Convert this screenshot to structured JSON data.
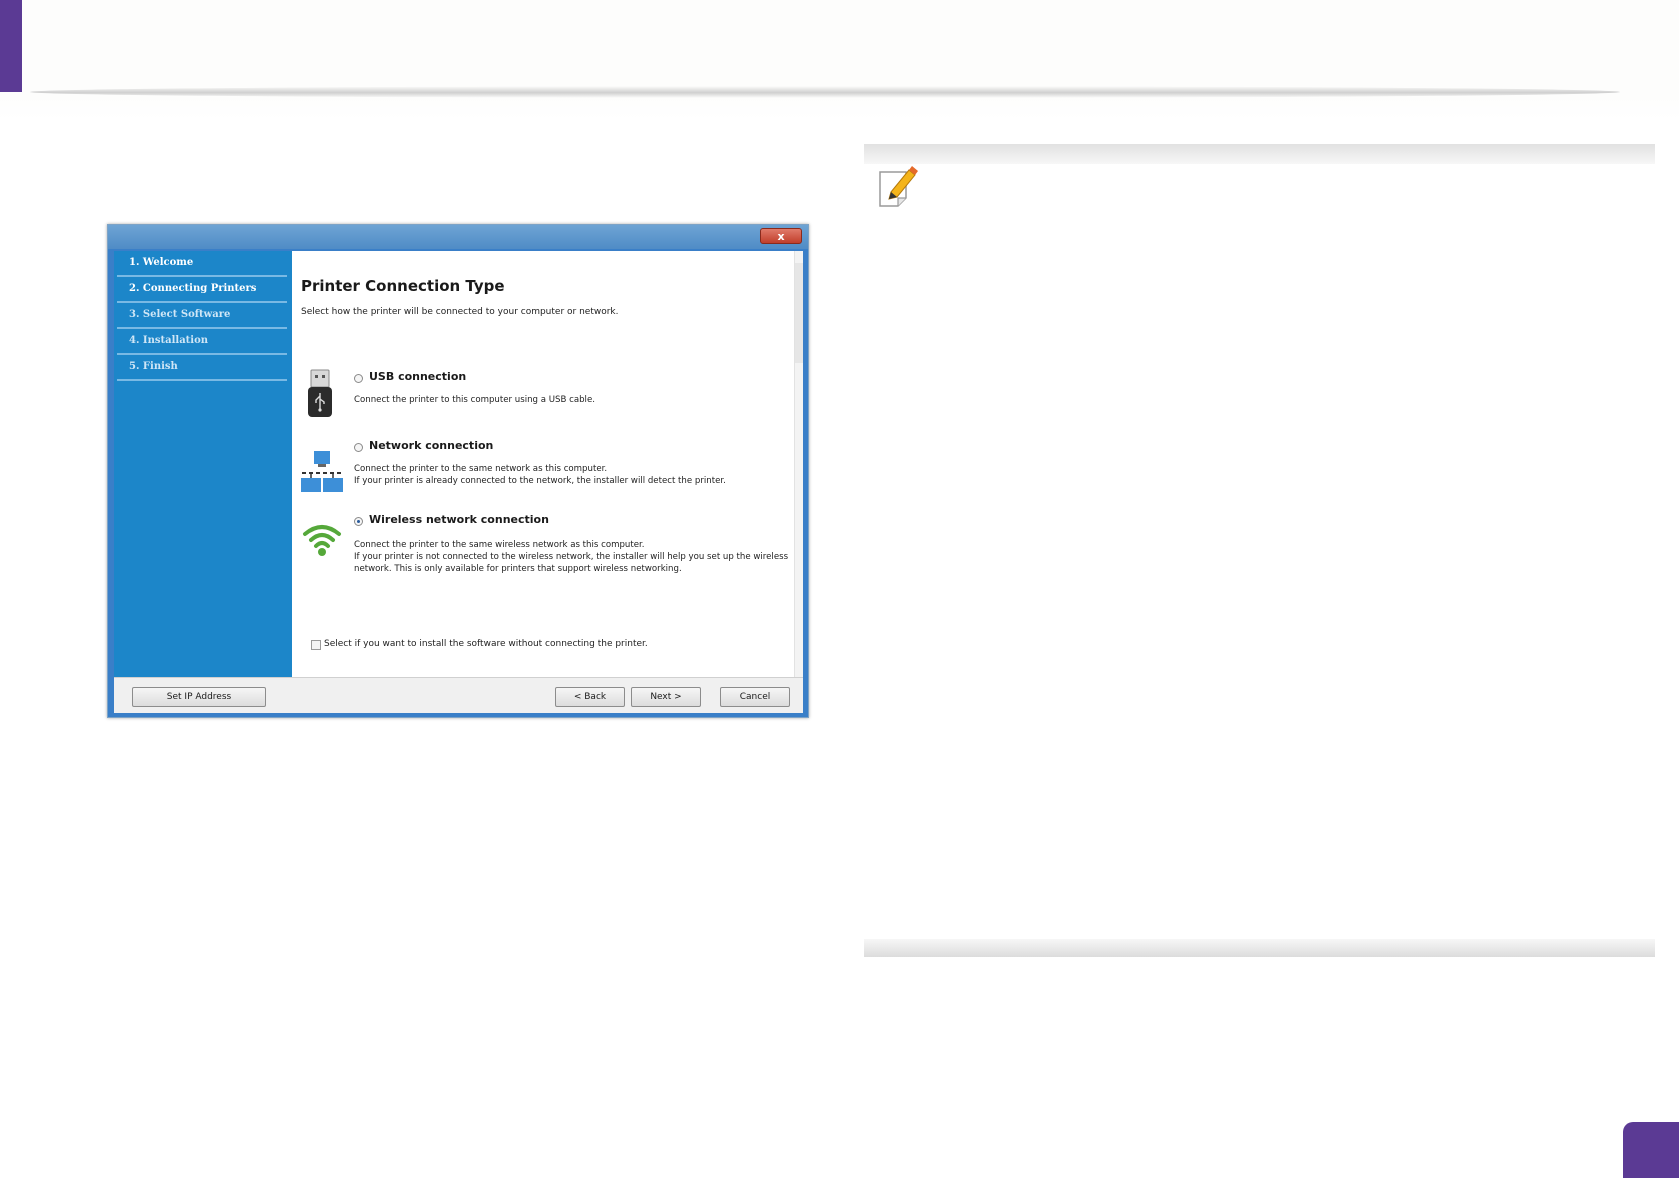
{
  "installer": {
    "close_label": "x",
    "steps": [
      {
        "label": "1. Welcome"
      },
      {
        "label": "2. Connecting Printers"
      },
      {
        "label": "3. Select Software"
      },
      {
        "label": "4. Installation"
      },
      {
        "label": "5. Finish"
      }
    ],
    "title": "Printer Connection Type",
    "description": "Select how the printer will be connected to your computer or network.",
    "options": [
      {
        "label": "USB connection",
        "description": "Connect the printer to this computer using a USB cable.",
        "icon": "usb-icon",
        "selected": false
      },
      {
        "label": "Network connection",
        "description": "Connect the printer to the same network as this computer.\nIf your printer is already connected to the network, the installer will detect the printer.",
        "icon": "network-icon",
        "selected": false
      },
      {
        "label": "Wireless network connection",
        "description": "Connect the printer to the same wireless network as this computer.\nIf your printer is not connected to the wireless network, the installer will help you set up the wireless network. This is only available for printers that support wireless networking.",
        "icon": "wifi-icon",
        "selected": true
      }
    ],
    "checkbox_label": "Select if you want to install the software without connecting the printer.",
    "buttons": {
      "set_ip": "Set IP Address",
      "back": "< Back",
      "next": "Next >",
      "cancel": "Cancel"
    }
  },
  "note": {
    "icon": "note-pencil-icon"
  },
  "colors": {
    "accent": "#5b3a94",
    "sidebar": "#1c86c9"
  }
}
